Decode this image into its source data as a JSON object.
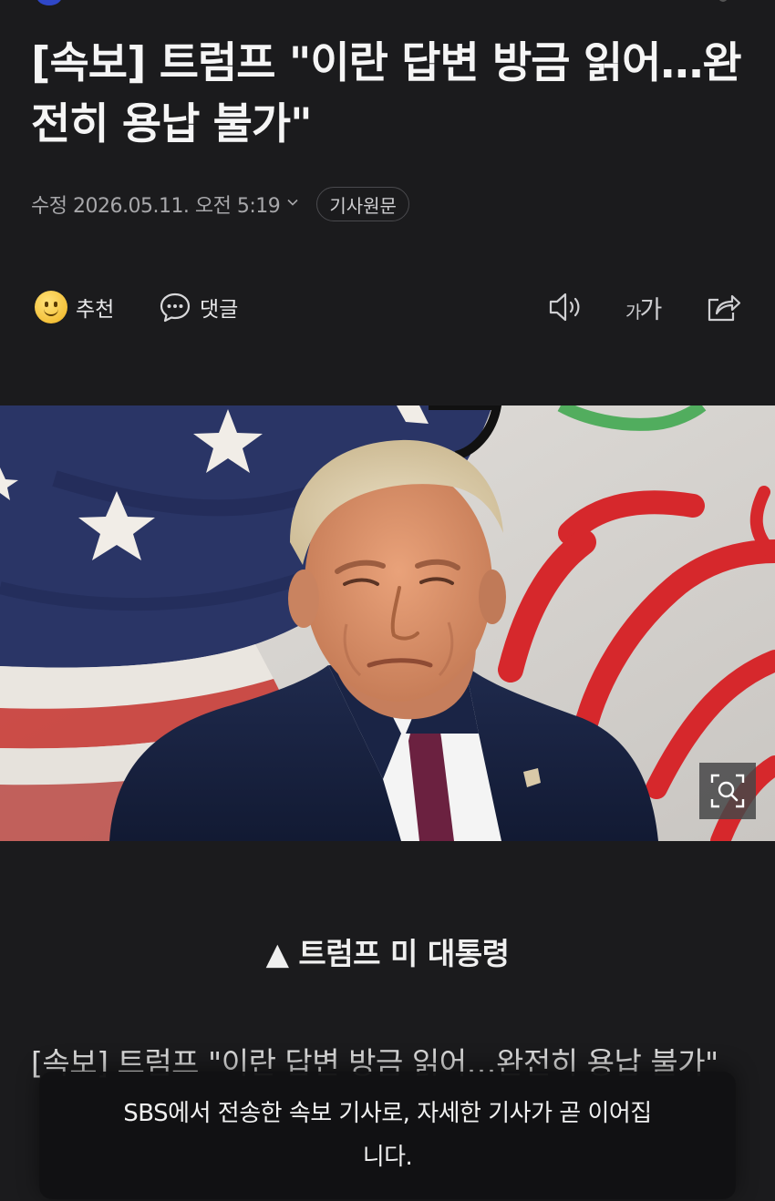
{
  "article": {
    "headline": "[속보] 트럼프 \"이란 답변 방금 읽어…완전히 용납 불가\"",
    "modified_date": "수정 2026.05.11. 오전 5:19",
    "original_article_label": "기사원문"
  },
  "actions": {
    "recommend_label": "추천",
    "comment_label": "댓글",
    "font_size_small": "가",
    "font_size_large": "가"
  },
  "image": {
    "caption": "▲ 트럼프 미 대통령"
  },
  "body": {
    "text": "[속보] 트럼프 \"이란 답변 방금 읽어…완전히 용납 불가\""
  },
  "toast": {
    "message": "SBS에서 전송한 속보 기사로, 자세한 기사가 곧 이어집니다."
  },
  "icons": [
    "smiley-icon",
    "speech-bubble-icon",
    "speaker-icon",
    "font-size-icon",
    "share-icon",
    "zoom-icon",
    "chevron-down-icon"
  ],
  "colors": {
    "background": "#1b1b1d",
    "flag_red": "#d6282c",
    "flag_blue": "#2a3566",
    "iran_green": "#3aa64a"
  }
}
